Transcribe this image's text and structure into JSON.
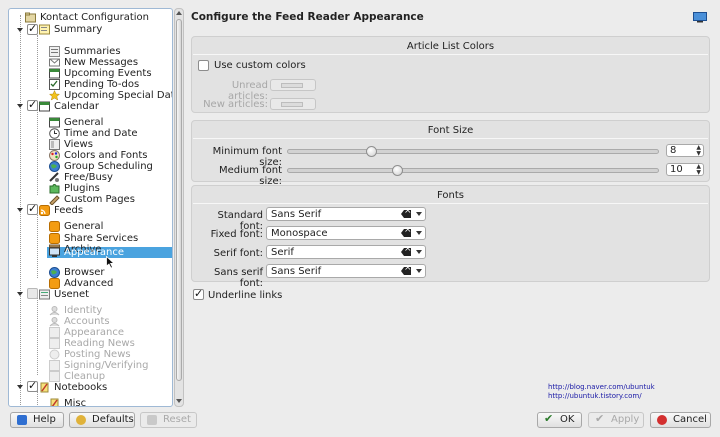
{
  "header": {
    "title": "Configure the Feed Reader Appearance"
  },
  "tree": {
    "items": [
      {
        "label": "Kontact Configuration",
        "disabled": false
      },
      {
        "label": "Summary",
        "disabled": false,
        "checked": true
      },
      {
        "label": "Summaries",
        "disabled": false
      },
      {
        "label": "New Messages",
        "disabled": false
      },
      {
        "label": "Upcoming Events",
        "disabled": false
      },
      {
        "label": "Pending To-dos",
        "disabled": false
      },
      {
        "label": "Upcoming Special Dates",
        "disabled": false
      },
      {
        "label": "Calendar",
        "disabled": false,
        "checked": true
      },
      {
        "label": "General",
        "disabled": false
      },
      {
        "label": "Time and Date",
        "disabled": false
      },
      {
        "label": "Views",
        "disabled": false
      },
      {
        "label": "Colors and Fonts",
        "disabled": false
      },
      {
        "label": "Group Scheduling",
        "disabled": false
      },
      {
        "label": "Free/Busy",
        "disabled": false
      },
      {
        "label": "Plugins",
        "disabled": false
      },
      {
        "label": "Custom Pages",
        "disabled": false
      },
      {
        "label": "Feeds",
        "disabled": false,
        "checked": true
      },
      {
        "label": "General",
        "disabled": false
      },
      {
        "label": "Share Services",
        "disabled": false
      },
      {
        "label": "Archive",
        "disabled": false
      },
      {
        "label": "Appearance",
        "disabled": false,
        "selected": true
      },
      {
        "label": "Browser",
        "disabled": false
      },
      {
        "label": "Advanced",
        "disabled": false
      },
      {
        "label": "Usenet",
        "disabled": false,
        "checked": false
      },
      {
        "label": "Identity",
        "disabled": true
      },
      {
        "label": "Accounts",
        "disabled": true
      },
      {
        "label": "Appearance",
        "disabled": true
      },
      {
        "label": "Reading News",
        "disabled": true
      },
      {
        "label": "Posting News",
        "disabled": true
      },
      {
        "label": "Signing/Verifying",
        "disabled": true
      },
      {
        "label": "Cleanup",
        "disabled": true
      },
      {
        "label": "Notebooks",
        "disabled": false,
        "checked": true
      },
      {
        "label": "Misc",
        "disabled": false
      }
    ]
  },
  "article_list_colors": {
    "title": "Article List Colors",
    "use_custom_colors": {
      "label": "Use custom colors",
      "checked": false
    },
    "unread_label": "Unread articles:",
    "new_label": "New articles:"
  },
  "font_size": {
    "title": "Font Size",
    "minimum": {
      "label": "Minimum font size:",
      "value": "8",
      "slider_fraction": 0.22
    },
    "medium": {
      "label": "Medium font size:",
      "value": "10",
      "slider_fraction": 0.29
    }
  },
  "fonts": {
    "title": "Fonts",
    "rows": [
      {
        "label": "Standard font:",
        "value": "Sans Serif"
      },
      {
        "label": "Fixed font:",
        "value": "Monospace"
      },
      {
        "label": "Serif font:",
        "value": "Serif"
      },
      {
        "label": "Sans serif font:",
        "value": "Sans Serif"
      }
    ]
  },
  "underline_links": {
    "label": "Underline links",
    "checked": true
  },
  "links": [
    "http://blog.naver.com/ubuntuk",
    "http://ubuntuk.tistory.com/"
  ],
  "buttons": {
    "help": "Help",
    "defaults": "Defaults",
    "reset": "Reset",
    "ok": "OK",
    "apply": "Apply",
    "cancel": "Cancel"
  },
  "colors": {
    "selection": "#4aa3df",
    "link": "#1a1aa6"
  }
}
